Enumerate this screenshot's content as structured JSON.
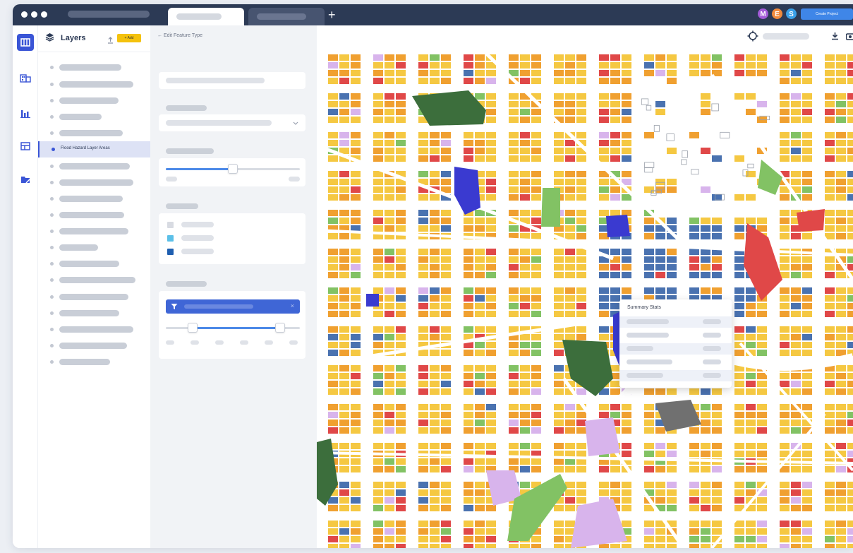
{
  "browser": {
    "avatars": [
      {
        "initial": "M",
        "color": "#a35bd8"
      },
      {
        "initial": "E",
        "color": "#f08a3c"
      },
      {
        "initial": "S",
        "color": "#3aa0e8"
      }
    ],
    "create_button": "Create Project",
    "new_tab_icon": "+"
  },
  "rail": {
    "icons": [
      "map-icon",
      "building-icon",
      "bar-chart-icon",
      "table-icon",
      "folder-icon"
    ]
  },
  "layers_panel": {
    "title": "Layers",
    "add_label": "+ Add",
    "selected_layer": "Flood Hazard Layer Areas"
  },
  "edit_panel": {
    "back_label": "← Edit Feature Type",
    "swatch_colors": [
      "#d8dbe2",
      "#5bc0e8",
      "#1f5fb0"
    ],
    "opacity_level": 0.5,
    "range_low": 0.2,
    "range_high": 0.85
  },
  "map": {
    "popup_title": "Summary Stats",
    "colors": {
      "residential": "#f5c842",
      "residential_dense": "#f0a030",
      "commercial": "#e04848",
      "downtown": "#4a72b0",
      "institutional": "#3a3ad0",
      "park": "#82c264",
      "forest": "#3c6e3c",
      "special": "#d8b4ec",
      "industrial": "#707070",
      "street": "#ffffff"
    }
  }
}
